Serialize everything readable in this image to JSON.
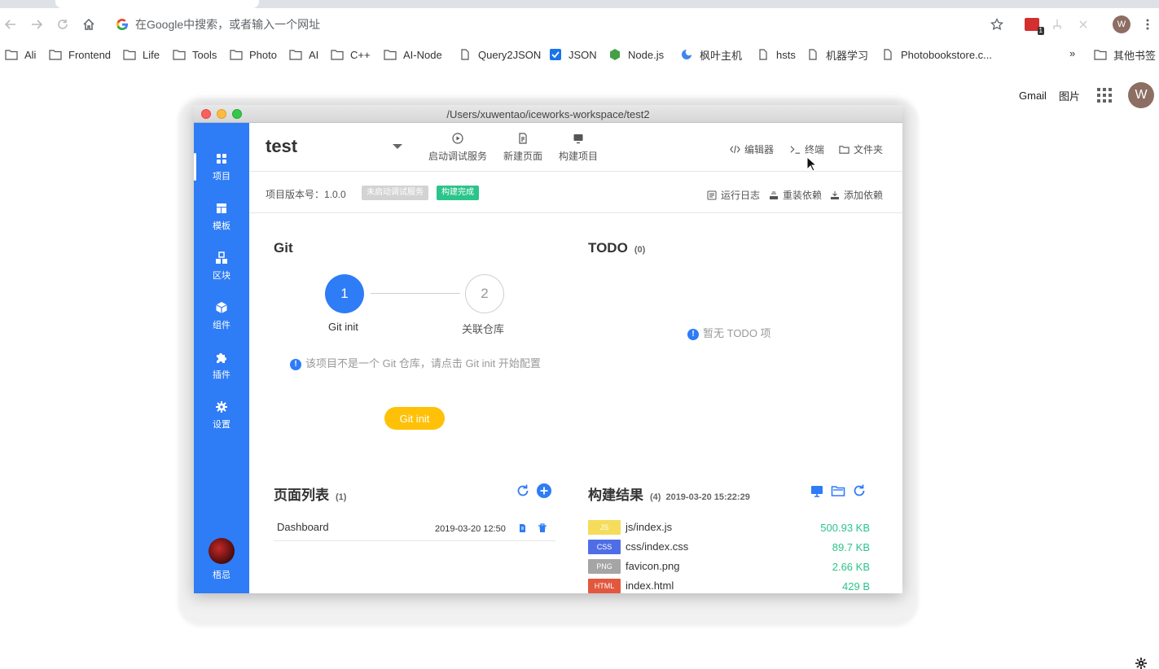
{
  "browser": {
    "omnibox_placeholder": "在Google中搜索，或者输入一个网址",
    "extension_badge": "1",
    "profile_initial": "W",
    "bookmarks": [
      {
        "label": "Ali",
        "icon": "folder-icon"
      },
      {
        "label": "Frontend",
        "icon": "folder-icon"
      },
      {
        "label": "Life",
        "icon": "folder-icon"
      },
      {
        "label": "Tools",
        "icon": "folder-icon"
      },
      {
        "label": "Photo",
        "icon": "folder-icon"
      },
      {
        "label": "AI",
        "icon": "folder-icon"
      },
      {
        "label": "C++",
        "icon": "folder-icon"
      },
      {
        "label": "AI-Node",
        "icon": "folder-icon"
      },
      {
        "label": "Query2JSON",
        "icon": "page-icon"
      },
      {
        "label": "JSON",
        "icon": "checkbox-icon"
      },
      {
        "label": "Node.js",
        "icon": "nodejs-icon"
      },
      {
        "label": "枫叶主机",
        "icon": "maple-icon"
      },
      {
        "label": "hsts",
        "icon": "page-icon"
      },
      {
        "label": "机器学习",
        "icon": "page-icon"
      },
      {
        "label": "Photobookstore.c...",
        "icon": "page-icon"
      }
    ],
    "bookmarks_more": "»",
    "other_bookmarks": "其他书签"
  },
  "google_bar": {
    "gmail": "Gmail",
    "images": "图片",
    "account_initial": "W"
  },
  "app": {
    "window_title": "/Users/xuwentao/iceworks-workspace/test2",
    "sidebar": [
      {
        "label": "项目",
        "icon": "dashboard-icon",
        "active": true
      },
      {
        "label": "模板",
        "icon": "template-icon",
        "active": false
      },
      {
        "label": "区块",
        "icon": "blocks-icon",
        "active": false
      },
      {
        "label": "组件",
        "icon": "cube-icon",
        "active": false
      },
      {
        "label": "插件",
        "icon": "puzzle-icon",
        "active": false
      },
      {
        "label": "设置",
        "icon": "gear-icon",
        "active": false
      }
    ],
    "user_name": "梧忌",
    "header": {
      "project_name": "test",
      "actions": [
        {
          "label": "启动调试服务",
          "icon": "play-icon"
        },
        {
          "label": "新建页面",
          "icon": "new-page-icon"
        },
        {
          "label": "构建项目",
          "icon": "monitor-icon"
        }
      ],
      "right_actions": [
        {
          "label": "编辑器",
          "icon": "code-icon"
        },
        {
          "label": "终端",
          "icon": "terminal-icon"
        },
        {
          "label": "文件夹",
          "icon": "folder-icon"
        }
      ]
    },
    "info": {
      "version_label": "项目版本号：1.0.0",
      "tag_dev": "未启动调试服务",
      "tag_build": "构建完成",
      "actions": [
        {
          "label": "运行日志",
          "icon": "log-icon"
        },
        {
          "label": "重装依赖",
          "icon": "reinstall-icon"
        },
        {
          "label": "添加依赖",
          "icon": "download-icon"
        }
      ]
    },
    "git": {
      "title": "Git",
      "steps": [
        {
          "number": "1",
          "label": "Git init"
        },
        {
          "number": "2",
          "label": "关联仓库"
        }
      ],
      "hint": "该项目不是一个 Git 仓库，请点击 Git init 开始配置",
      "button": "Git init"
    },
    "todo": {
      "title": "TODO",
      "count": "(0)",
      "empty": "暂无 TODO 项"
    },
    "pages": {
      "title": "页面列表",
      "count": "(1)",
      "rows": [
        {
          "name": "Dashboard",
          "date": "2019-03-20 12:50"
        }
      ]
    },
    "build": {
      "title": "构建结果",
      "count": "(4)",
      "time": "2019-03-20 15:22:29",
      "files": [
        {
          "type": "JS",
          "name": "js/index.js",
          "size": "500.93 KB",
          "color": "#f5dc5a"
        },
        {
          "type": "CSS",
          "name": "css/index.css",
          "size": "89.7 KB",
          "color": "#4f6ee6"
        },
        {
          "type": "PNG",
          "name": "favicon.png",
          "size": "2.66 KB",
          "color": "#a5a5a5"
        },
        {
          "type": "HTML",
          "name": "index.html",
          "size": "429 B",
          "color": "#e2583e"
        }
      ]
    },
    "colors": {
      "primary": "#2e7cf6",
      "success": "#2bc48a",
      "warning": "#ffc107"
    }
  }
}
